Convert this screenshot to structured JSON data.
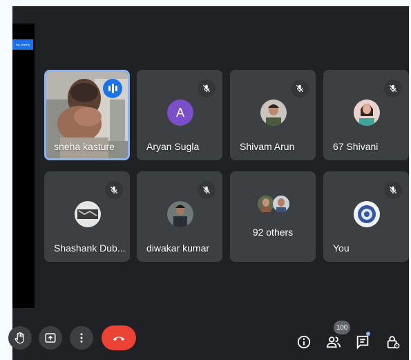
{
  "share_banner": {
    "stop_label": "top sharing"
  },
  "participants": [
    {
      "name": "sneha kasture",
      "state": "speaking"
    },
    {
      "name": "Aryan Sugla",
      "avatar_letter": "A",
      "state": "muted"
    },
    {
      "name": "Shivam Arun",
      "state": "muted"
    },
    {
      "name": "67 Shivani",
      "state": "muted"
    },
    {
      "name": "Shashank Dub...",
      "state": "muted"
    },
    {
      "name": "diwakar kumar",
      "state": "muted"
    },
    {
      "name": "You",
      "state": "muted"
    }
  ],
  "others_tile": {
    "label": "92 others"
  },
  "toolbar": {
    "people_count": "100",
    "icons": [
      "raise-hand-icon",
      "present-icon",
      "more-options-icon",
      "end-call-icon",
      "info-icon",
      "people-icon",
      "chat-icon",
      "host-controls-icon"
    ]
  },
  "colors": {
    "background": "#202124",
    "tile": "#3c4043",
    "accent": "#1a73e8",
    "end_call": "#ea4335",
    "active_border": "#8ab4f8"
  }
}
